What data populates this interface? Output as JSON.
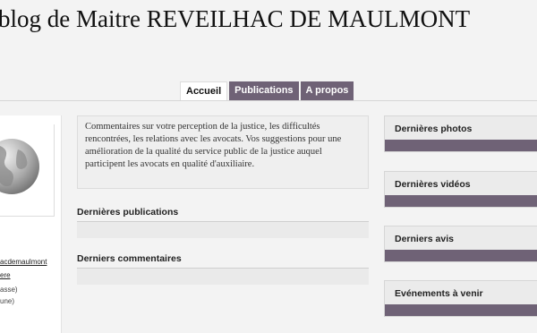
{
  "header": {
    "title": "blog de Maitre REVEILHAC DE MAULMONT"
  },
  "tabs": [
    {
      "label": "Accueil",
      "active": true
    },
    {
      "label": "Publications",
      "active": false
    },
    {
      "label": "A propos",
      "active": false
    }
  ],
  "sidebar_left": {
    "link1": "acdemaulmont",
    "link2": "ere",
    "line3": "asse)",
    "line4": "une)"
  },
  "main": {
    "intro": "Commentaires sur votre perception de la justice, les difficultés rencontrées, les relations avec les avocats. Vos suggestions pour une amélioration de la qualité du service public de la justice auquel participent les avocats en qualité d'auxiliaire.",
    "sections": [
      {
        "title": "Dernières publications"
      },
      {
        "title": "Derniers commentaires"
      }
    ]
  },
  "sidebar_right": {
    "widgets": [
      {
        "title": "Dernières photos"
      },
      {
        "title": "Dernières vidéos"
      },
      {
        "title": "Derniers avis"
      },
      {
        "title": "Evénements à venir"
      }
    ]
  },
  "colors": {
    "tab_inactive": "#6f6276",
    "background": "#f3f3f3"
  }
}
